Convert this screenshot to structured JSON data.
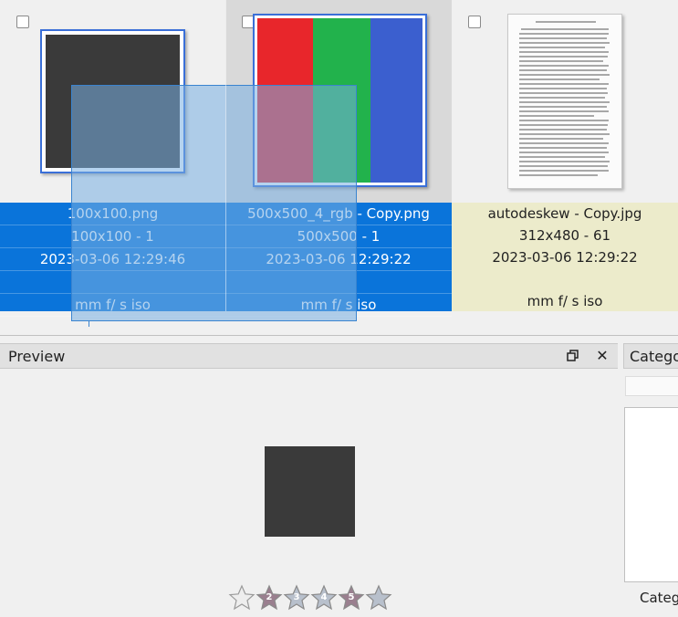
{
  "thumbnails": [
    {
      "filename": "100x100.png",
      "dims": "100x100 - 1",
      "date": "2023-03-06 12:29:46",
      "blank": "",
      "exposure": "mm f/ s iso",
      "state": "selected"
    },
    {
      "filename": "500x500_4_rgb - Copy.png",
      "dims": "500x500 - 1",
      "date": "2023-03-06 12:29:22",
      "blank": "",
      "exposure": "mm f/ s iso",
      "state": "selected-hover"
    },
    {
      "filename": "autodeskew - Copy.jpg",
      "dims": "312x480 - 61",
      "date": "2023-03-06 12:29:22",
      "blank": "",
      "exposure": "mm f/ s iso",
      "state": "unselected"
    }
  ],
  "preview": {
    "title": "Preview",
    "restore_icon": "restore-window-icon",
    "close_icon": "close-icon",
    "rating": [
      "1",
      "2",
      "3",
      "4",
      "5"
    ]
  },
  "category": {
    "title": "Catego",
    "footer": "Categ"
  },
  "colors": {
    "selection_blue": "#0a74da",
    "unselected_info": "#ecebcb",
    "thumb_border": "#3a6fd8"
  }
}
